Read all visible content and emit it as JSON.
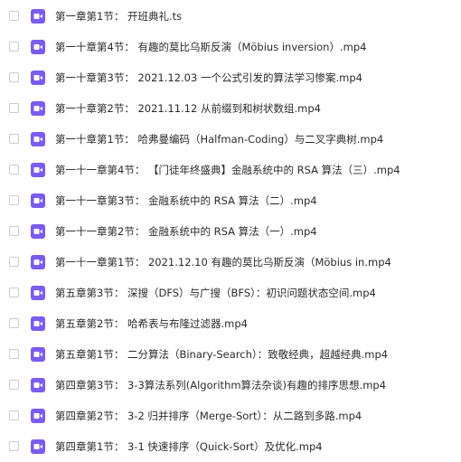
{
  "files": {
    "items": [
      {
        "name": "第一章第1节：  开班典礼.ts"
      },
      {
        "name": "第一十章第4节：  有趣的莫比乌斯反演（Möbius inversion）.mp4"
      },
      {
        "name": "第一十章第3节：  2021.12.03 一个公式引发的算法学习惨案.mp4"
      },
      {
        "name": "第一十章第2节：  2021.11.12 从前缀到和树状数组.mp4"
      },
      {
        "name": "第一十章第1节：  哈弗曼编码（Halfman-Coding）与二叉字典树.mp4"
      },
      {
        "name": "第一十一章第4节：  【门徒年终盛典】金融系统中的 RSA 算法（三）.mp4"
      },
      {
        "name": "第一十一章第3节：  金融系统中的 RSA 算法（二）.mp4"
      },
      {
        "name": "第一十一章第2节：  金融系统中的 RSA 算法（一）.mp4"
      },
      {
        "name": "第一十一章第1节：  2021.12.10 有趣的莫比乌斯反演（Möbius in.mp4"
      },
      {
        "name": "第五章第3节：  深搜（DFS）与广搜（BFS）：初识问题状态空间.mp4"
      },
      {
        "name": "第五章第2节：  哈希表与布隆过滤器.mp4"
      },
      {
        "name": "第五章第1节：  二分算法（Binary-Search）：致敬经典，超越经典.mp4"
      },
      {
        "name": "第四章第3节：  3-3算法系列(Algorithm算法杂谈)有趣的排序思想.mp4"
      },
      {
        "name": "第四章第2节：  3-2 归并排序（Merge-Sort）：从二路到多路.mp4"
      },
      {
        "name": "第四章第1节：  3-1 快速排序（Quick-Sort）及优化.mp4"
      }
    ]
  },
  "icon": {
    "name": "video-file-icon",
    "color": "#7b5cf0"
  }
}
